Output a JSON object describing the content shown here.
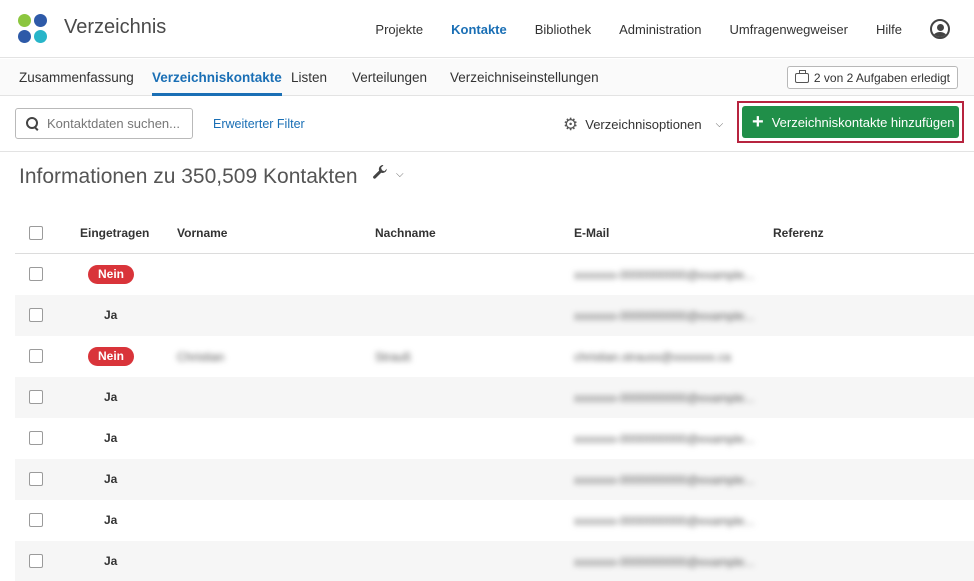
{
  "app": {
    "title": "Verzeichnis"
  },
  "topnav": {
    "items": [
      {
        "label": "Projekte",
        "active": false
      },
      {
        "label": "Kontakte",
        "active": true
      },
      {
        "label": "Bibliothek",
        "active": false
      },
      {
        "label": "Administration",
        "active": false
      },
      {
        "label": "Umfragenwegweiser",
        "active": false
      },
      {
        "label": "Hilfe",
        "active": false
      }
    ]
  },
  "subtabs": {
    "items": [
      {
        "label": "Zusammenfassung",
        "active": false
      },
      {
        "label": "Verzeichniskontakte",
        "active": true
      },
      {
        "label": "Listen",
        "active": false
      },
      {
        "label": "Verteilungen",
        "active": false
      },
      {
        "label": "Verzeichniseinstellungen",
        "active": false
      }
    ],
    "tasks_label": "2 von 2 Aufgaben erledigt"
  },
  "toolbar": {
    "search_placeholder": "Kontaktdaten suchen...",
    "advanced_filter_label": "Erweiterter Filter",
    "directory_options_label": "Verzeichnisoptionen",
    "add_contacts_label": "Verzeichniskontakte hinzufügen"
  },
  "main": {
    "heading": "Informationen zu 350,509 Kontakten"
  },
  "table": {
    "headers": {
      "subscribed": "Eingetragen",
      "first_name": "Vorname",
      "last_name": "Nachname",
      "email": "E-Mail",
      "reference": "Referenz"
    },
    "rows": [
      {
        "subscribed": "Nein",
        "first_name": "",
        "last_name": "",
        "email": "xxxxxxx-0000000000@example...",
        "reference": ""
      },
      {
        "subscribed": "Ja",
        "first_name": "",
        "last_name": "",
        "email": "xxxxxxx-0000000000@example...",
        "reference": ""
      },
      {
        "subscribed": "Nein",
        "first_name": "Christian",
        "last_name": "Strauß",
        "email": "christian.strauss@xxxxxxx.ca",
        "reference": ""
      },
      {
        "subscribed": "Ja",
        "first_name": "",
        "last_name": "",
        "email": "xxxxxxx-0000000000@example...",
        "reference": ""
      },
      {
        "subscribed": "Ja",
        "first_name": "",
        "last_name": "",
        "email": "xxxxxxx-0000000000@example...",
        "reference": ""
      },
      {
        "subscribed": "Ja",
        "first_name": "",
        "last_name": "",
        "email": "xxxxxxx-0000000000@example...",
        "reference": ""
      },
      {
        "subscribed": "Ja",
        "first_name": "",
        "last_name": "",
        "email": "xxxxxxx-0000000000@example...",
        "reference": ""
      },
      {
        "subscribed": "Ja",
        "first_name": "",
        "last_name": "",
        "email": "xxxxxxx-0000000000@example...",
        "reference": ""
      }
    ]
  },
  "colors": {
    "accent": "#1a6fb5",
    "primary_button": "#208f49",
    "badge_no": "#d9343a",
    "highlight_outline": "#b7243f"
  },
  "icons": {
    "logo": "four-dots-logo",
    "user": "user-circle-icon",
    "tasks": "briefcase-icon",
    "search": "search-icon",
    "options": "gear-icon",
    "add": "plus-icon",
    "tools": "wrench-icon"
  }
}
